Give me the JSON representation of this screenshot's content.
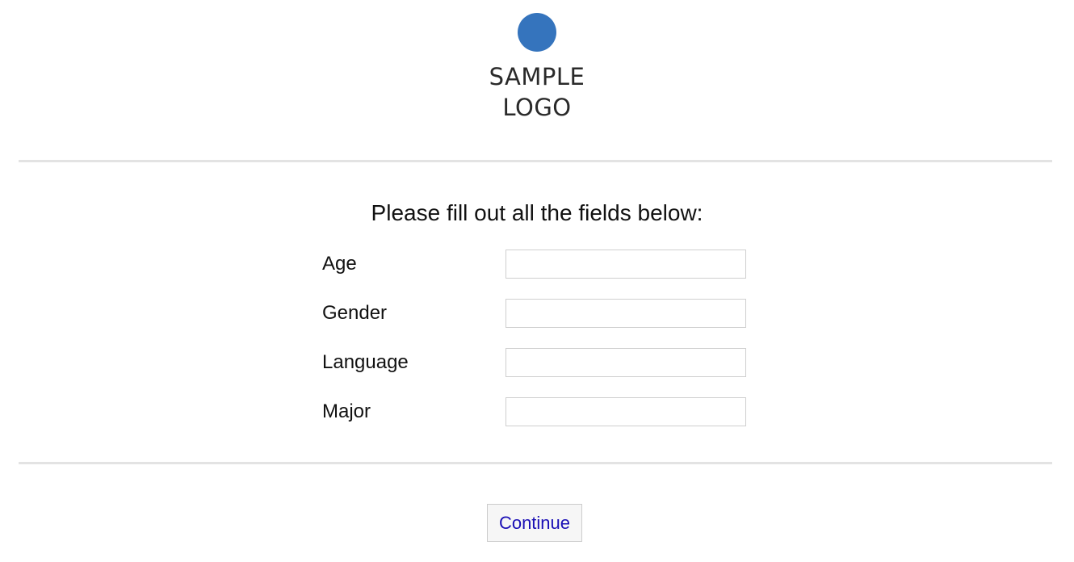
{
  "logo": {
    "line1": "SAMPLE",
    "line2": "LOGO",
    "circle_color": "#3574bd"
  },
  "form": {
    "instructions": "Please fill out all the fields below:",
    "fields": [
      {
        "label": "Age",
        "value": "",
        "placeholder": ""
      },
      {
        "label": "Gender",
        "value": "",
        "placeholder": ""
      },
      {
        "label": "Language",
        "value": "",
        "placeholder": ""
      },
      {
        "label": "Major",
        "value": "",
        "placeholder": ""
      }
    ]
  },
  "actions": {
    "continue_label": "Continue",
    "link_color": "#1a0fb5"
  }
}
